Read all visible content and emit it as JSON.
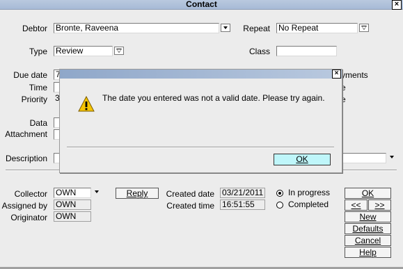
{
  "window": {
    "title": "Contact",
    "close": "×"
  },
  "form": {
    "debtor_label": "Debtor",
    "debtor_value": "Bronte, Raveena",
    "repeat_label": "Repeat",
    "repeat_value": "No Repeat",
    "type_label": "Type",
    "type_value": "Review",
    "class_label": "Class",
    "class_value": "",
    "due_date_label": "Due date",
    "due_date_value": "7",
    "time_label": "Time",
    "priority_label": "Priority",
    "priority_value": "3",
    "data_label": "Data",
    "attachment_label": "Attachment",
    "description_label": "Description",
    "payments_fragment": "yments",
    "frag_e1": "e",
    "frag_e2": "e"
  },
  "lower": {
    "collector_label": "Collector",
    "collector_value": "OWN",
    "assigned_label": "Assigned by",
    "assigned_value": "OWN",
    "originator_label": "Originator",
    "originator_value": "OWN",
    "reply_label": "Reply",
    "created_date_label": "Created date",
    "created_date_value": "03/21/2011",
    "created_time_label": "Created time",
    "created_time_value": "16:51:55",
    "in_progress_label": "In progress",
    "completed_label": "Completed",
    "status_selected": "In progress"
  },
  "buttons": {
    "ok": "OK",
    "prev": "<<",
    "next": ">>",
    "new": "New",
    "defaults": "Defaults",
    "cancel": "Cancel",
    "help": "Help"
  },
  "dialog": {
    "message": "The date you entered was not a valid date. Please try again.",
    "ok": "OK",
    "close": "×",
    "icon": "warning-icon"
  }
}
